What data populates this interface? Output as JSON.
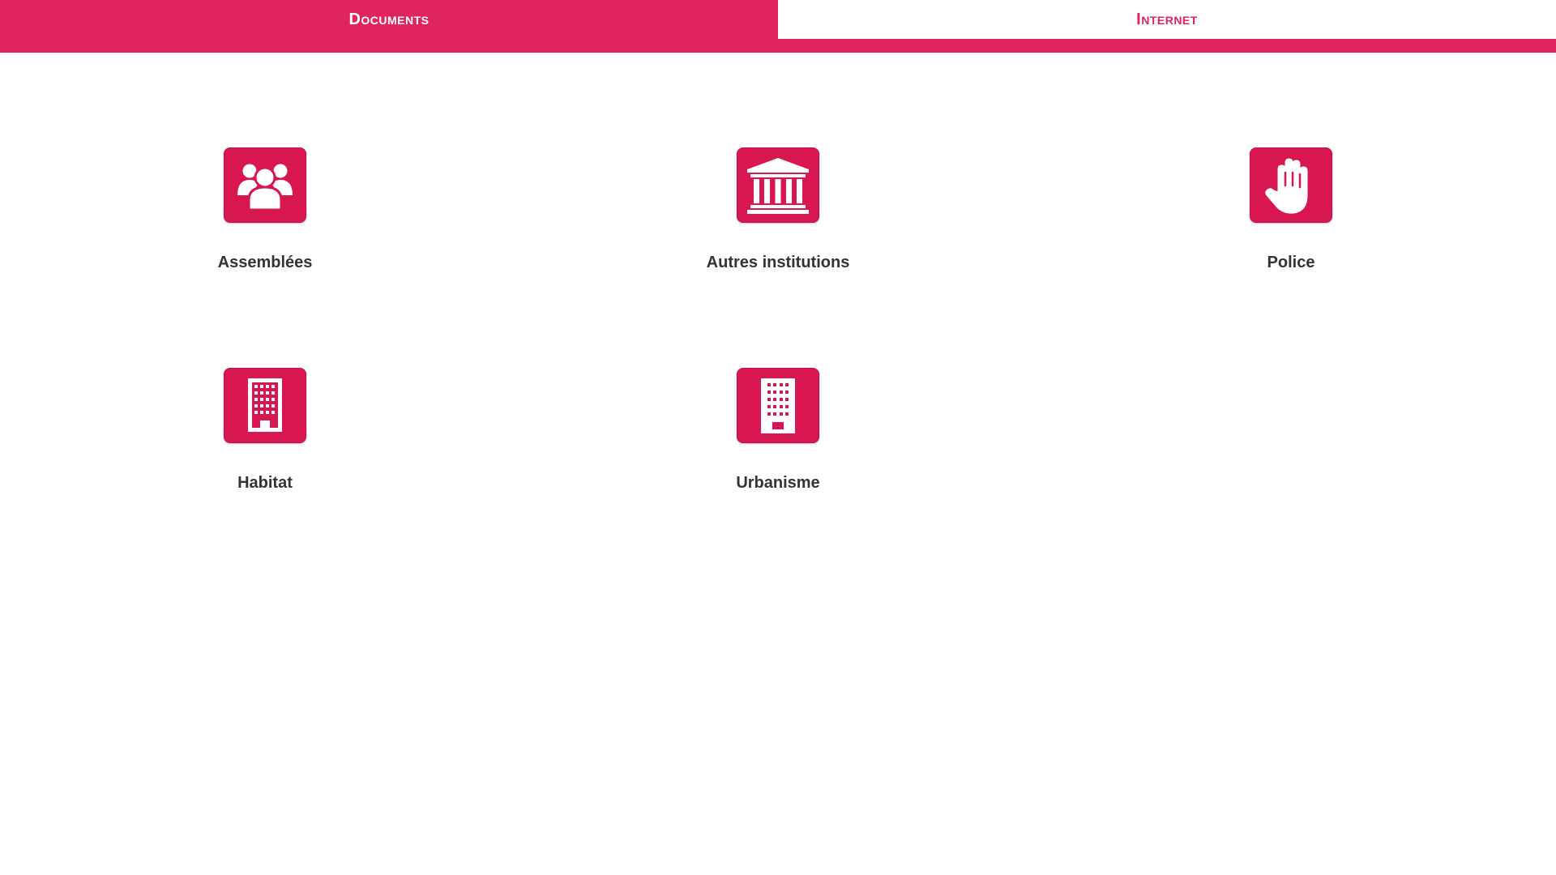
{
  "tabs": {
    "documents": "Documents",
    "internet": "Internet"
  },
  "colors": {
    "accent": "#e0245e",
    "tile": "#d8164f",
    "label": "#333333"
  },
  "tiles": [
    {
      "label": "Assemblées",
      "icon": "users-group-icon"
    },
    {
      "label": "Autres institutions",
      "icon": "institution-icon"
    },
    {
      "label": "Police",
      "icon": "hand-stop-icon"
    },
    {
      "label": "Habitat",
      "icon": "building-icon"
    },
    {
      "label": "Urbanisme",
      "icon": "building-tower-icon"
    }
  ]
}
